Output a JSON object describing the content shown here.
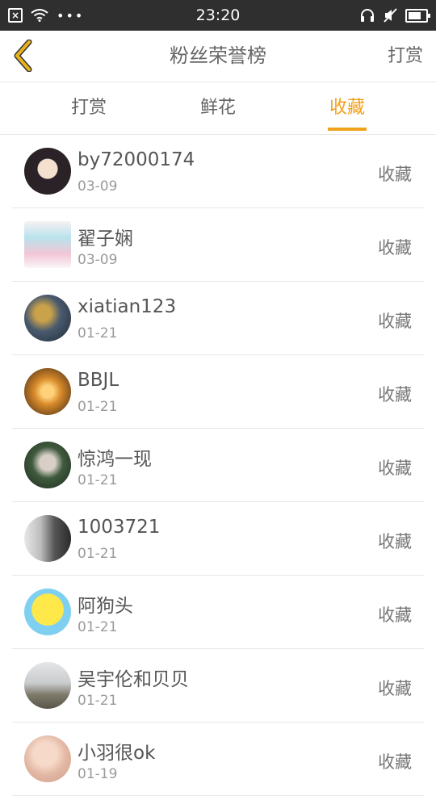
{
  "status_bar": {
    "time": "23:20",
    "left_icons": [
      "close-box-icon",
      "wifi-icon",
      "more-dots-icon"
    ],
    "right_icons": [
      "headphones-icon",
      "mute-icon",
      "battery-icon"
    ]
  },
  "header": {
    "title": "粉丝荣誉榜",
    "action_label": "打赏"
  },
  "tabs": [
    {
      "label": "打赏",
      "active": false
    },
    {
      "label": "鲜花",
      "active": false
    },
    {
      "label": "收藏",
      "active": true
    }
  ],
  "colors": {
    "accent": "#f0a21c",
    "status_bar_bg": "#2f2f2f",
    "back_arrow": "#e8b21b"
  },
  "fans": [
    {
      "name": "by72000174",
      "date": "03-09",
      "type": "收藏",
      "avatar_icon": "anime-girl-avatar"
    },
    {
      "name": "翟子娴",
      "date": "03-09",
      "type": "收藏",
      "avatar_icon": "anime-character-avatar"
    },
    {
      "name": "xiatian123",
      "date": "01-21",
      "type": "收藏",
      "avatar_icon": "game-hero-avatar"
    },
    {
      "name": "BBJL",
      "date": "01-21",
      "type": "收藏",
      "avatar_icon": "lantern-avatar"
    },
    {
      "name": "惊鸿一现",
      "date": "01-21",
      "type": "收藏",
      "avatar_icon": "portrait-avatar"
    },
    {
      "name": "1003721",
      "date": "01-21",
      "type": "收藏",
      "avatar_icon": "bw-portrait-avatar"
    },
    {
      "name": "阿狗头",
      "date": "01-21",
      "type": "收藏",
      "avatar_icon": "sponge-cartoon-avatar"
    },
    {
      "name": "吴宇伦和贝贝",
      "date": "01-21",
      "type": "收藏",
      "avatar_icon": "landscape-avatar"
    },
    {
      "name": "小羽很ok",
      "date": "01-19",
      "type": "收藏",
      "avatar_icon": "girl-photo-avatar"
    }
  ]
}
